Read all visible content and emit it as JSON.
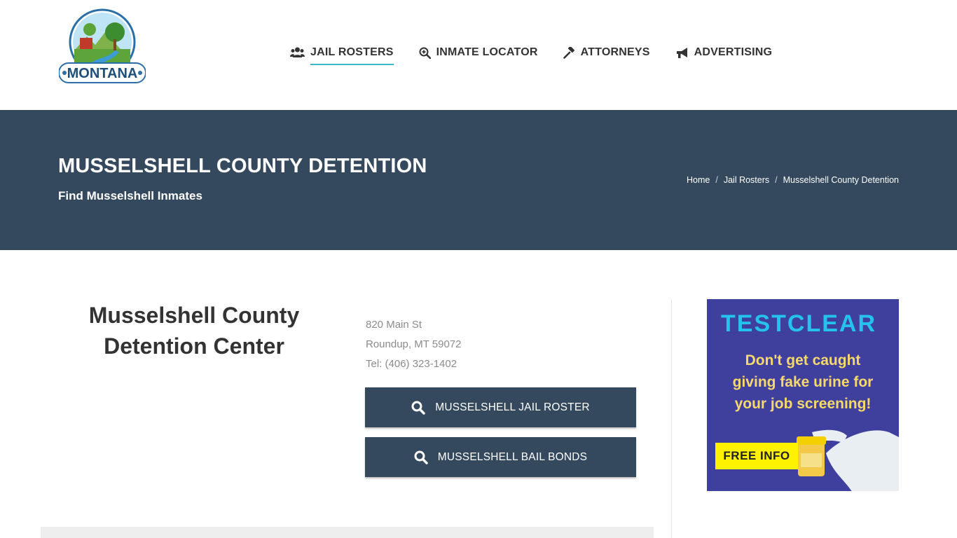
{
  "header": {
    "logo_text": "MONTANA",
    "nav": [
      {
        "label": "JAIL ROSTERS",
        "icon": "users-icon",
        "active": true
      },
      {
        "label": "INMATE LOCATOR",
        "icon": "search-plus-icon",
        "active": false
      },
      {
        "label": "ATTORNEYS",
        "icon": "gavel-icon",
        "active": false
      },
      {
        "label": "ADVERTISING",
        "icon": "megaphone-icon",
        "active": false
      }
    ]
  },
  "banner": {
    "title": "MUSSELSHELL COUNTY DETENTION",
    "subtitle": "Find Musselshell Inmates",
    "breadcrumb": [
      "Home",
      "Jail Rosters",
      "Musselshell County Detention"
    ],
    "separator": "/"
  },
  "facility": {
    "name_line1": "Musselshell County",
    "name_line2": "Detention Center",
    "street": "820 Main St",
    "city": "Roundup, MT 59072",
    "phone": "Tel: (406) 323-1402"
  },
  "buttons": {
    "roster_label": "MUSSELSHELL JAIL ROSTER",
    "bail_label": "MUSSELSHELL BAIL BONDS"
  },
  "ad": {
    "brand": "TESTCLEAR",
    "headline_line1": "Don't get caught",
    "headline_line2": "giving fake urine for",
    "headline_line3": "your job screening!",
    "cta": "FREE INFO"
  },
  "colors": {
    "banner_bg": "#35495e",
    "accent": "#39b8c9",
    "ad_bg": "#3f3f9e",
    "ad_brand": "#25c2f0",
    "ad_text": "#f7d96b",
    "ad_cta_bg": "#fff200"
  }
}
